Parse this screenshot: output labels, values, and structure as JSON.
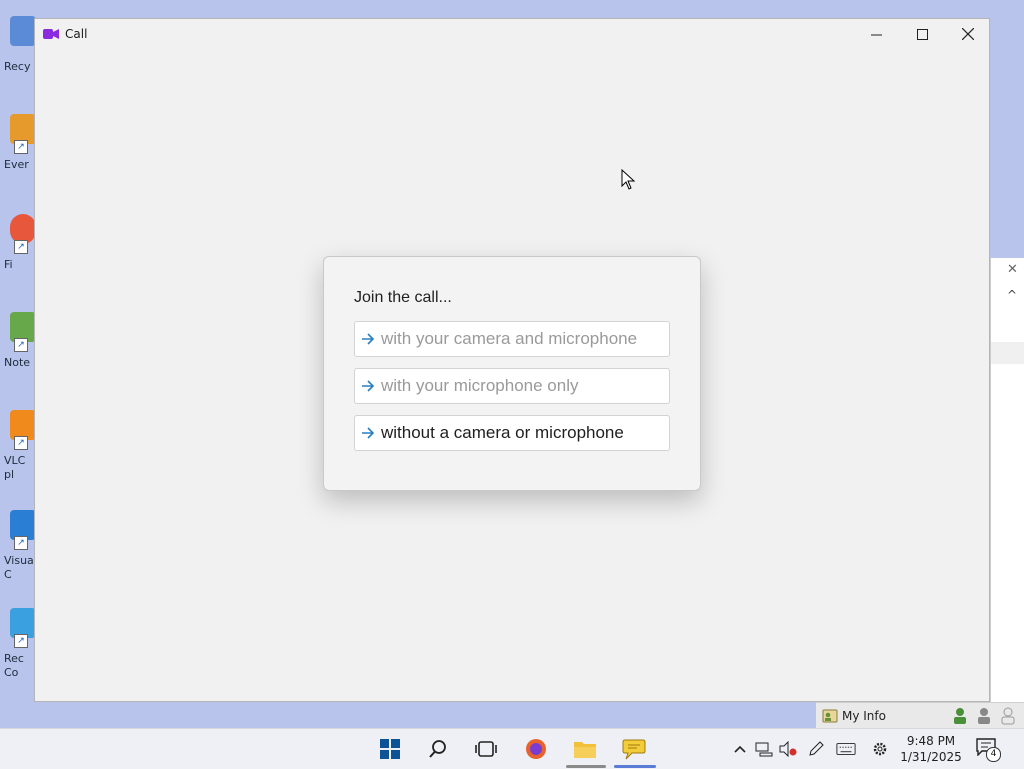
{
  "desktop": {
    "icons": [
      {
        "label": "Recy",
        "color": "#5b8bd6"
      },
      {
        "label": "Ever",
        "color": "#e59a2b"
      },
      {
        "label": "Fi",
        "color": "#e6573b"
      },
      {
        "label": "Note",
        "color": "#66a84a"
      },
      {
        "label": "VLC\npl",
        "color": "#f08a1c"
      },
      {
        "label": "Visua\nC",
        "color": "#2a7fd4"
      },
      {
        "label": "Rec\nCo",
        "color": "#3aa0e0"
      }
    ]
  },
  "call_window": {
    "title": "Call",
    "icon": "video-camera-icon",
    "controls": {
      "minimize": "—",
      "maximize": "☐",
      "close": "✕"
    }
  },
  "join_dialog": {
    "title": "Join the call...",
    "options": [
      {
        "label": "with your camera and microphone",
        "enabled": false
      },
      {
        "label": "with your microphone only",
        "enabled": false
      },
      {
        "label": "without a camera or microphone",
        "enabled": true
      }
    ],
    "arrow_color": "#2a7fc1"
  },
  "background_app": {
    "close": "✕",
    "chevron": "^",
    "status": {
      "my_info": "My Info"
    }
  },
  "taskbar": {
    "clock": {
      "time": "9:48 PM",
      "date": "1/31/2025"
    },
    "notification_count": "4",
    "tray_chevron": "^"
  },
  "colors": {
    "accent": "#2a7fc1",
    "call_icon": "#8a2be2"
  }
}
